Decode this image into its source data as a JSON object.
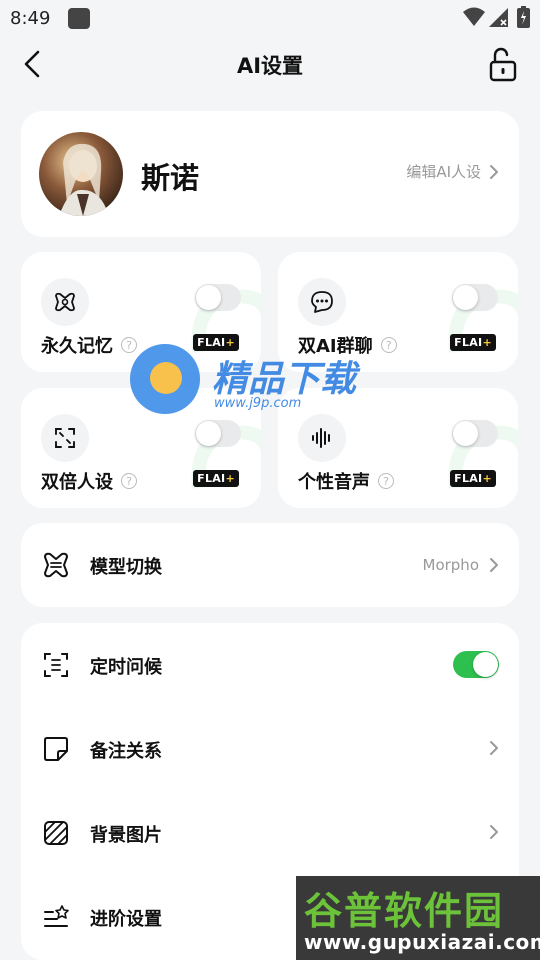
{
  "status_bar": {
    "time": "8:49"
  },
  "header": {
    "title": "AI设置"
  },
  "profile": {
    "name": "斯诺",
    "edit_label": "编辑AI人设"
  },
  "features": [
    {
      "label": "永久记忆",
      "badge": "FLAI",
      "badge_plus": "+",
      "enabled": false,
      "icon": "memory-icon"
    },
    {
      "label": "双AI群聊",
      "badge": "FLAI",
      "badge_plus": "+",
      "enabled": false,
      "icon": "group-chat-icon"
    },
    {
      "label": "双倍人设",
      "badge": "FLAI",
      "badge_plus": "+",
      "enabled": false,
      "icon": "expand-icon"
    },
    {
      "label": "个性音声",
      "badge": "FLAI",
      "badge_plus": "+",
      "enabled": false,
      "icon": "voice-wave-icon"
    }
  ],
  "help_mark": "?",
  "model": {
    "label": "模型切换",
    "value": "Morpho",
    "icon": "model-icon"
  },
  "settings": [
    {
      "label": "定时问候",
      "type": "toggle",
      "enabled": true,
      "icon": "timer-icon"
    },
    {
      "label": "备注关系",
      "type": "link",
      "icon": "note-icon"
    },
    {
      "label": "背景图片",
      "type": "link",
      "icon": "background-icon"
    },
    {
      "label": "进阶设置",
      "type": "link",
      "icon": "advanced-icon"
    }
  ],
  "watermarks": {
    "top_text": "精品下载",
    "top_url": "www.j9p.com",
    "bottom_cn": "谷普软件园",
    "bottom_en": "www.gupuxiazai.com"
  },
  "colors": {
    "toggle_on": "#2ec04f",
    "background": "#f4f5f7",
    "card": "#ffffff",
    "badge_plus": "#f5c842"
  }
}
